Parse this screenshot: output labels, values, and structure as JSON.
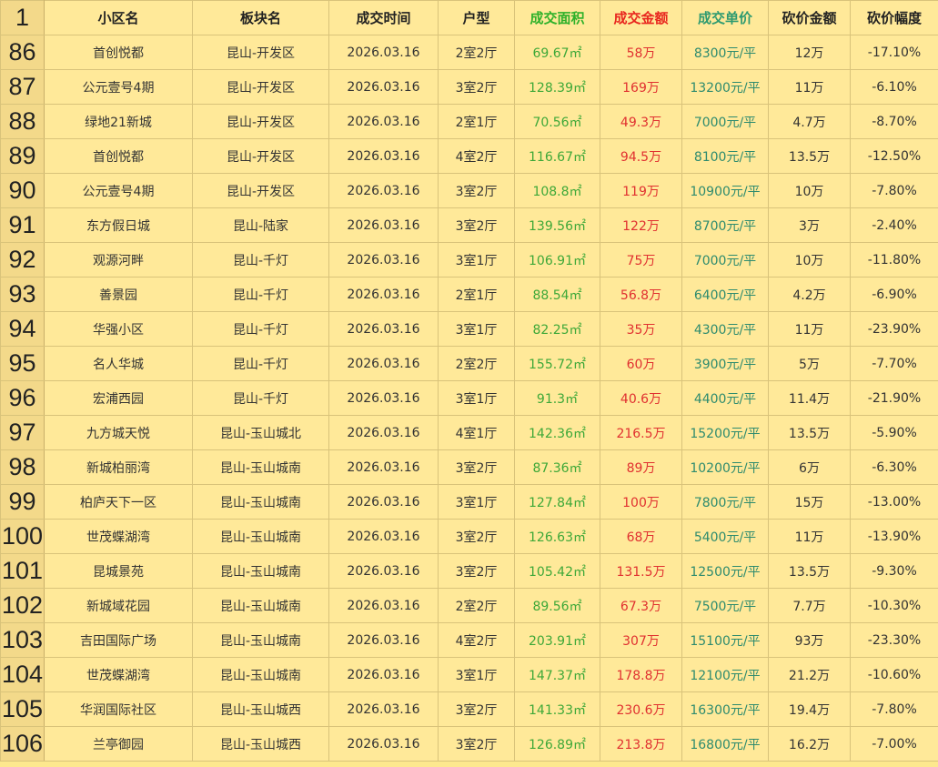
{
  "sheet": {
    "header_row_number": "1",
    "headers": [
      "小区名",
      "板块名",
      "成交时间",
      "户型",
      "成交面积",
      "成交金额",
      "成交单价",
      "砍价金额",
      "砍价幅度"
    ],
    "colors": {
      "area": "#3ea838",
      "amount": "#e03030",
      "unit_price": "#2e8b6e",
      "background": "#ffe999"
    },
    "rows": [
      {
        "n": "86",
        "c": [
          "首创悦都",
          "昆山-开发区",
          "2026.03.16",
          "2室2厅",
          "69.67㎡",
          "58万",
          "8300元/平",
          "12万",
          "-17.10%"
        ]
      },
      {
        "n": "87",
        "c": [
          "公元壹号4期",
          "昆山-开发区",
          "2026.03.16",
          "3室2厅",
          "128.39㎡",
          "169万",
          "13200元/平",
          "11万",
          "-6.10%"
        ]
      },
      {
        "n": "88",
        "c": [
          "绿地21新城",
          "昆山-开发区",
          "2026.03.16",
          "2室1厅",
          "70.56㎡",
          "49.3万",
          "7000元/平",
          "4.7万",
          "-8.70%"
        ]
      },
      {
        "n": "89",
        "c": [
          "首创悦都",
          "昆山-开发区",
          "2026.03.16",
          "4室2厅",
          "116.67㎡",
          "94.5万",
          "8100元/平",
          "13.5万",
          "-12.50%"
        ]
      },
      {
        "n": "90",
        "c": [
          "公元壹号4期",
          "昆山-开发区",
          "2026.03.16",
          "3室2厅",
          "108.8㎡",
          "119万",
          "10900元/平",
          "10万",
          "-7.80%"
        ]
      },
      {
        "n": "91",
        "c": [
          "东方假日城",
          "昆山-陆家",
          "2026.03.16",
          "3室2厅",
          "139.56㎡",
          "122万",
          "8700元/平",
          "3万",
          "-2.40%"
        ]
      },
      {
        "n": "92",
        "c": [
          "观源河畔",
          "昆山-千灯",
          "2026.03.16",
          "3室1厅",
          "106.91㎡",
          "75万",
          "7000元/平",
          "10万",
          "-11.80%"
        ]
      },
      {
        "n": "93",
        "c": [
          "善景园",
          "昆山-千灯",
          "2026.03.16",
          "2室1厅",
          "88.54㎡",
          "56.8万",
          "6400元/平",
          "4.2万",
          "-6.90%"
        ]
      },
      {
        "n": "94",
        "c": [
          "华强小区",
          "昆山-千灯",
          "2026.03.16",
          "3室1厅",
          "82.25㎡",
          "35万",
          "4300元/平",
          "11万",
          "-23.90%"
        ]
      },
      {
        "n": "95",
        "c": [
          "名人华城",
          "昆山-千灯",
          "2026.03.16",
          "2室2厅",
          "155.72㎡",
          "60万",
          "3900元/平",
          "5万",
          "-7.70%"
        ]
      },
      {
        "n": "96",
        "c": [
          "宏浦西园",
          "昆山-千灯",
          "2026.03.16",
          "3室1厅",
          "91.3㎡",
          "40.6万",
          "4400元/平",
          "11.4万",
          "-21.90%"
        ]
      },
      {
        "n": "97",
        "c": [
          "九方城天悦",
          "昆山-玉山城北",
          "2026.03.16",
          "4室1厅",
          "142.36㎡",
          "216.5万",
          "15200元/平",
          "13.5万",
          "-5.90%"
        ]
      },
      {
        "n": "98",
        "c": [
          "新城柏丽湾",
          "昆山-玉山城南",
          "2026.03.16",
          "3室2厅",
          "87.36㎡",
          "89万",
          "10200元/平",
          "6万",
          "-6.30%"
        ]
      },
      {
        "n": "99",
        "c": [
          "柏庐天下一区",
          "昆山-玉山城南",
          "2026.03.16",
          "3室1厅",
          "127.84㎡",
          "100万",
          "7800元/平",
          "15万",
          "-13.00%"
        ]
      },
      {
        "n": "100",
        "c": [
          "世茂蝶湖湾",
          "昆山-玉山城南",
          "2026.03.16",
          "3室2厅",
          "126.63㎡",
          "68万",
          "5400元/平",
          "11万",
          "-13.90%"
        ]
      },
      {
        "n": "101",
        "c": [
          "昆城景苑",
          "昆山-玉山城南",
          "2026.03.16",
          "3室2厅",
          "105.42㎡",
          "131.5万",
          "12500元/平",
          "13.5万",
          "-9.30%"
        ]
      },
      {
        "n": "102",
        "c": [
          "新城域花园",
          "昆山-玉山城南",
          "2026.03.16",
          "2室2厅",
          "89.56㎡",
          "67.3万",
          "7500元/平",
          "7.7万",
          "-10.30%"
        ]
      },
      {
        "n": "103",
        "c": [
          "吉田国际广场",
          "昆山-玉山城南",
          "2026.03.16",
          "4室2厅",
          "203.91㎡",
          "307万",
          "15100元/平",
          "93万",
          "-23.30%"
        ]
      },
      {
        "n": "104",
        "c": [
          "世茂蝶湖湾",
          "昆山-玉山城南",
          "2026.03.16",
          "3室1厅",
          "147.37㎡",
          "178.8万",
          "12100元/平",
          "21.2万",
          "-10.60%"
        ]
      },
      {
        "n": "105",
        "c": [
          "华润国际社区",
          "昆山-玉山城西",
          "2026.03.16",
          "3室2厅",
          "141.33㎡",
          "230.6万",
          "16300元/平",
          "19.4万",
          "-7.80%"
        ]
      },
      {
        "n": "106",
        "c": [
          "兰亭御园",
          "昆山-玉山城西",
          "2026.03.16",
          "3室2厅",
          "126.89㎡",
          "213.8万",
          "16800元/平",
          "16.2万",
          "-7.00%"
        ]
      }
    ]
  }
}
